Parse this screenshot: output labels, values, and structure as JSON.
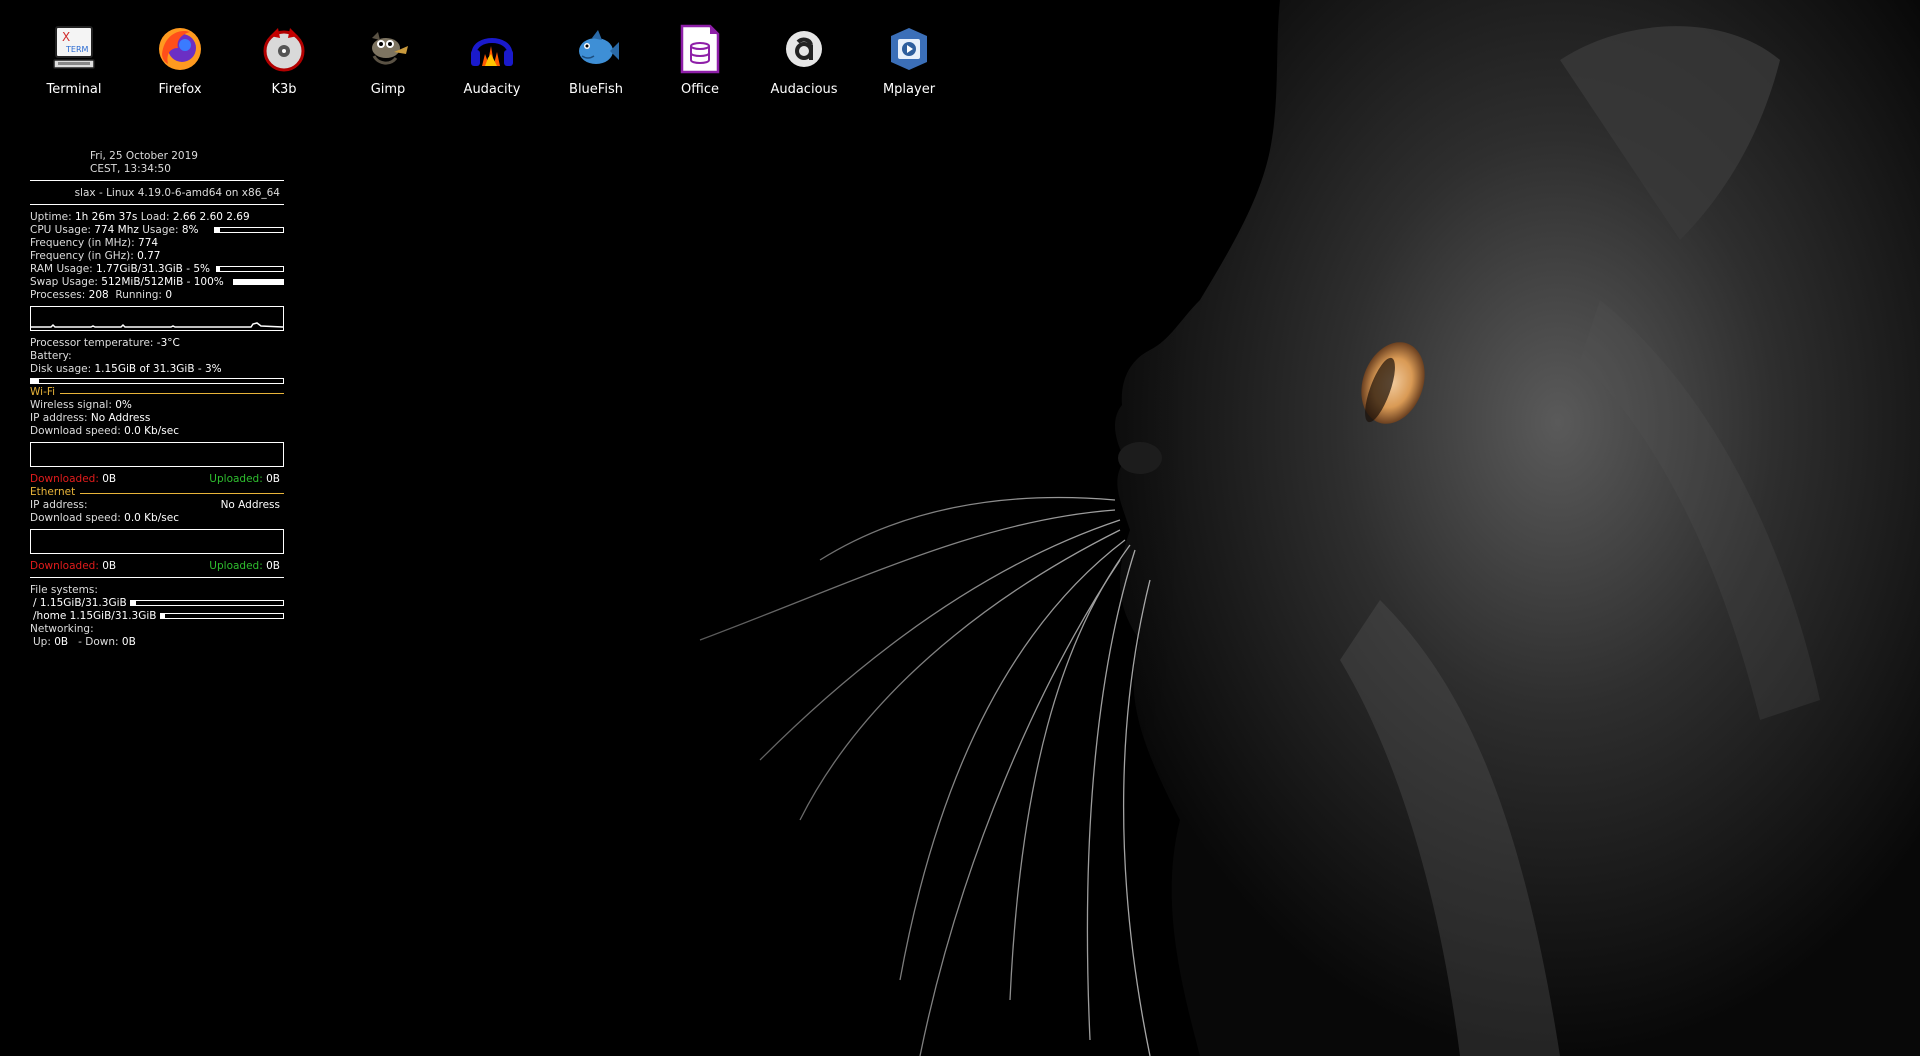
{
  "desktop_icons": [
    {
      "label": "Terminal",
      "icon": "xterm-icon"
    },
    {
      "label": "Firefox",
      "icon": "firefox-icon"
    },
    {
      "label": "K3b",
      "icon": "k3b-icon"
    },
    {
      "label": "Gimp",
      "icon": "gimp-icon"
    },
    {
      "label": "Audacity",
      "icon": "audacity-icon"
    },
    {
      "label": "BlueFish",
      "icon": "bluefish-icon"
    },
    {
      "label": "Office",
      "icon": "office-icon"
    },
    {
      "label": "Audacious",
      "icon": "audacious-icon"
    },
    {
      "label": "Mplayer",
      "icon": "mplayer-icon"
    }
  ],
  "xterm_glyph": {
    "x": "X",
    "term": "TERM"
  },
  "conky": {
    "date_line": "Fri,  25 October 2019",
    "time_line": "CEST,    13:34:50",
    "system_line": "slax - Linux 4.19.0-6-amd64 on x86_64",
    "uptime_label": "Uptime:",
    "uptime_value": "1h 26m 37s",
    "load_label": "Load:",
    "load_value": "2.66 2.60 2.69",
    "cpu_label": "CPU Usage:",
    "cpu_freq": "774 Mhz",
    "cpu_usage_label": "Usage:",
    "cpu_usage_value": "8%",
    "cpu_usage_fraction": 0.08,
    "freq_mhz_label": "Frequency (in MHz):",
    "freq_mhz_value": "774",
    "freq_ghz_label": "Frequency (in GHz):",
    "freq_ghz_value": "0.77",
    "ram_label": "RAM Usage:",
    "ram_value": "1.77GiB/31.3GiB - 5%",
    "ram_fraction": 0.05,
    "swap_label": "Swap Usage:",
    "swap_value": "512MiB/512MiB - 100%",
    "swap_fraction": 1.0,
    "processes_label": "Processes:",
    "processes_value": "208",
    "running_label": "Running:",
    "running_value": "0",
    "temp_label": "Processor temperature:",
    "temp_value": "-3°C",
    "battery_label": "Battery:",
    "disk_label": "Disk usage:",
    "disk_value": "1.15GiB of 31.3GiB - 3%",
    "disk_fraction": 0.03,
    "wifi_title": "Wi-Fi",
    "wireless_label": "Wireless signal:",
    "wireless_value": "0%",
    "wifi_ip_label": "IP address:",
    "wifi_ip_value": "No Address",
    "wifi_dl_label": "Download speed:",
    "wifi_dl_value": "0.0 Kb/sec",
    "wifi_downloaded_label": "Downloaded:",
    "wifi_downloaded_value": "0B",
    "wifi_uploaded_label": "Uploaded:",
    "wifi_uploaded_value": "0B",
    "eth_title": "Ethernet",
    "eth_ip_label": "IP address:",
    "eth_ip_value": "No Address",
    "eth_dl_label": "Download speed:",
    "eth_dl_value": "0.0 Kb/sec",
    "eth_downloaded_label": "Downloaded:",
    "eth_downloaded_value": "0B",
    "eth_uploaded_label": "Uploaded:",
    "eth_uploaded_value": "0B",
    "fs_label": "File systems:",
    "fs_root_label": "/",
    "fs_root_value": "1.15GiB/31.3GiB",
    "fs_root_fraction": 0.03,
    "fs_home_label": "/home",
    "fs_home_value": "1.15GiB/31.3GiB",
    "fs_home_fraction": 0.03,
    "net_label": "Networking:",
    "net_up_label": "Up:",
    "net_up_value": "0B",
    "net_down_label": "- Down:",
    "net_down_value": "0B"
  },
  "colors": {
    "section_accent": "#e8b43a",
    "downloaded": "#e21c1c",
    "uploaded": "#2fbf2f"
  }
}
